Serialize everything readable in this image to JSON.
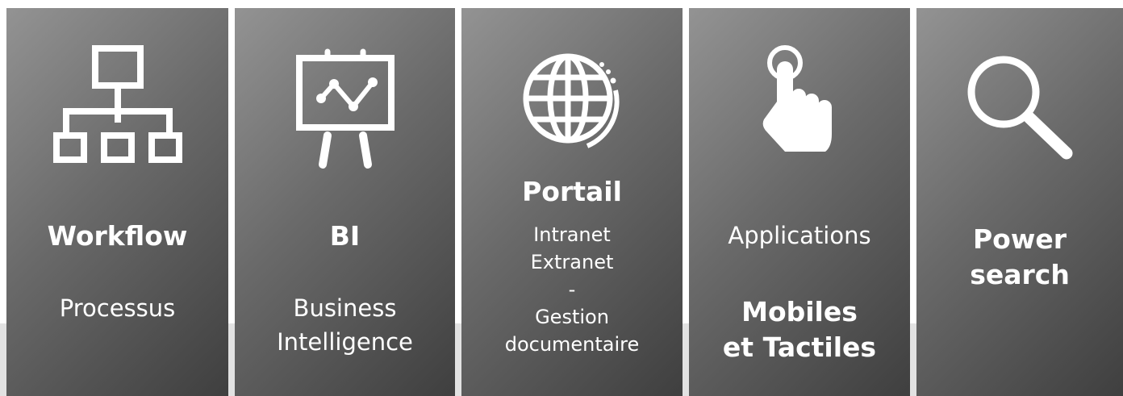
{
  "panels": [
    {
      "id": "workflow",
      "icon": "org-chart-icon",
      "title": "Workflow",
      "subtitle": "Processus"
    },
    {
      "id": "bi",
      "icon": "presentation-chart-icon",
      "title": "BI",
      "subtitle_lines": [
        "Business",
        "Intelligence"
      ]
    },
    {
      "id": "portail",
      "icon": "globe-icon",
      "title": "Portail",
      "lines": [
        "Intranet",
        "Extranet",
        "-",
        "Gestion",
        "documentaire"
      ]
    },
    {
      "id": "applications",
      "icon": "touch-hand-icon",
      "title": "Applications",
      "subtitle_lines": [
        "Mobiles",
        "et Tactiles"
      ]
    },
    {
      "id": "power-search",
      "icon": "magnifier-icon",
      "title_lines": [
        "Power",
        "search"
      ]
    }
  ],
  "colors": {
    "panel_light": "#939393",
    "panel_dark": "#3f3f3f",
    "strip": "#e2e2e2",
    "text": "#ffffff"
  }
}
